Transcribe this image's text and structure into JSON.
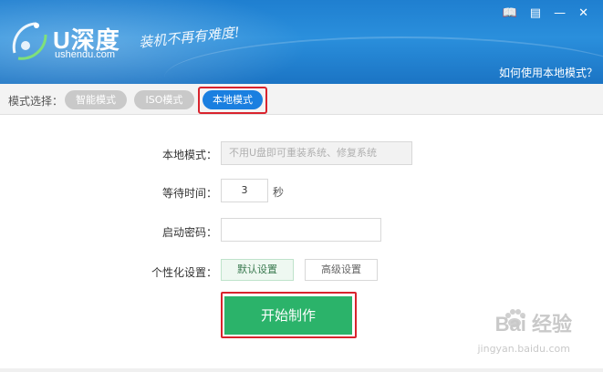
{
  "header": {
    "brand_name": "U深度",
    "brand_url": "ushendu.com",
    "slogan": "装机不再有难度!",
    "help_link": "如何使用本地模式？"
  },
  "mode_bar": {
    "label": "模式选择：",
    "tabs": [
      {
        "label": "智能模式",
        "active": false
      },
      {
        "label": "ISO模式",
        "active": false
      },
      {
        "label": "本地模式",
        "active": true
      }
    ]
  },
  "form": {
    "local_mode_label": "本地模式：",
    "local_mode_value": "不用U盘即可重装系统、修复系统",
    "wait_time_label": "等待时间：",
    "wait_time_value": "3",
    "wait_time_unit": "秒",
    "boot_password_label": "启动密码：",
    "boot_password_value": "",
    "personalize_label": "个性化设置：",
    "default_settings": "默认设置",
    "advanced_settings": "高级设置"
  },
  "start_button": "开始制作",
  "watermark": {
    "text": "Bai 经验",
    "sub": "jingyan.baidu.com"
  },
  "colors": {
    "header_blue": "#1f7fd0",
    "active_tab": "#1a7fe0",
    "start_green": "#2bb36a",
    "highlight_red": "#d9232d"
  },
  "icons": [
    "logo-icon",
    "book-icon",
    "message-icon",
    "minimize-icon",
    "close-icon",
    "baidu-paw-icon"
  ]
}
